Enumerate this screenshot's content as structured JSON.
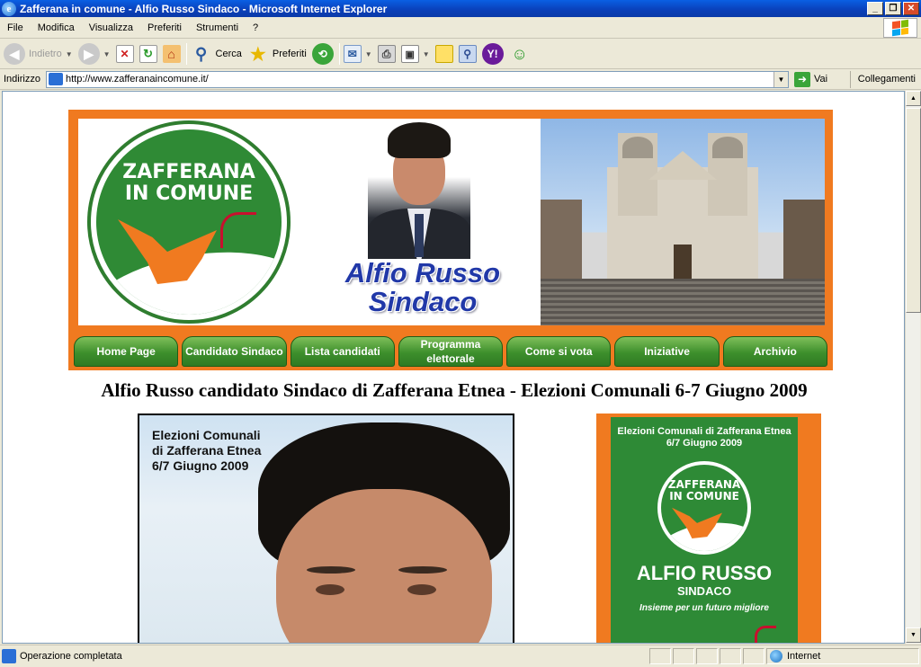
{
  "window": {
    "title": "Zafferana in comune - Alfio Russo Sindaco - Microsoft Internet Explorer",
    "ie_icon": "e",
    "buttons": {
      "minimize": "_",
      "maximize": "❐",
      "close": "✕"
    }
  },
  "menu": [
    "File",
    "Modifica",
    "Visualizza",
    "Preferiti",
    "Strumenti",
    "?"
  ],
  "toolbar": {
    "back_label": "Indietro",
    "search_label": "Cerca",
    "favorites_label": "Preferiti"
  },
  "address": {
    "label": "Indirizzo",
    "url": "http://www.zafferanaincomune.it/",
    "go_label": "Vai",
    "links_label": "Collegamenti"
  },
  "page": {
    "logo_text_1": "ZAFFERANA",
    "logo_text_2": "IN COMUNE",
    "candidate_line1": "Alfio Russo",
    "candidate_line2": "Sindaco",
    "nav": [
      {
        "label": "Home Page"
      },
      {
        "label": "Candidato Sindaco"
      },
      {
        "label": "Lista candidati"
      },
      {
        "label": "Programma elettorale"
      },
      {
        "label": "Come si vota"
      },
      {
        "label": "Iniziative"
      },
      {
        "label": "Archivio"
      }
    ],
    "headline": "Alfio Russo candidato Sindaco di Zafferana Etnea - Elezioni Comunali 6-7 Giugno 2009",
    "poster_left": {
      "line1": "Elezioni Comunali",
      "line2": "di Zafferana Etnea",
      "line3": "6/7 Giugno 2009"
    },
    "poster_right": {
      "line1": "Elezioni Comunali di Zafferana Etnea",
      "line2": "6/7 Giugno 2009",
      "logo_1": "ZAFFERANA",
      "logo_2": "IN COMUNE",
      "name": "ALFIO RUSSO",
      "role": "SINDACO",
      "slogan": "Insieme per un futuro migliore"
    }
  },
  "status": {
    "text": "Operazione completata",
    "zone": "Internet"
  },
  "colors": {
    "brand_orange": "#f07a20",
    "brand_green": "#2f8a35",
    "title_blue": "#2138a8"
  }
}
